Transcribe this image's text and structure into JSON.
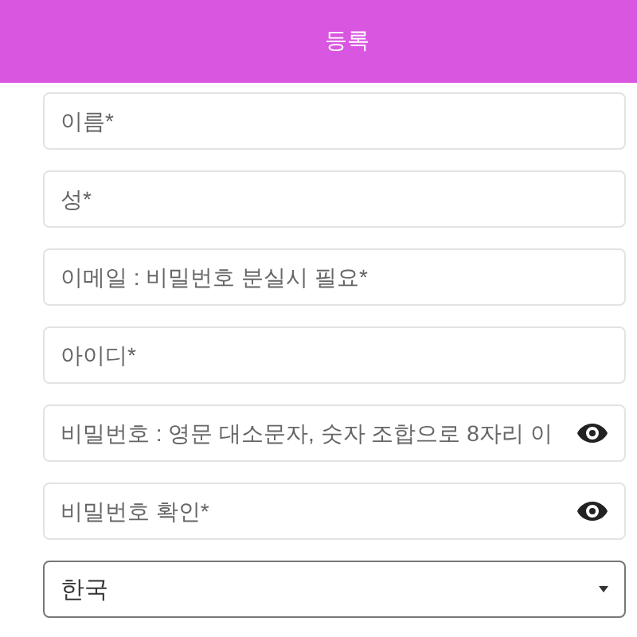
{
  "header": {
    "title": "등록"
  },
  "fields": [
    {
      "kind": "text",
      "placeholder": "이름*"
    },
    {
      "kind": "text",
      "placeholder": "성*"
    },
    {
      "kind": "text",
      "placeholder": "이메일 : 비밀번호 분실시 필요*"
    },
    {
      "kind": "text",
      "placeholder": "아이디*"
    },
    {
      "kind": "password",
      "placeholder": "비밀번호 : 영문 대소문자, 숫자 조합으로 8자리 이"
    },
    {
      "kind": "password",
      "placeholder": "비밀번호 확인*"
    },
    {
      "kind": "select",
      "value": "한국"
    }
  ]
}
